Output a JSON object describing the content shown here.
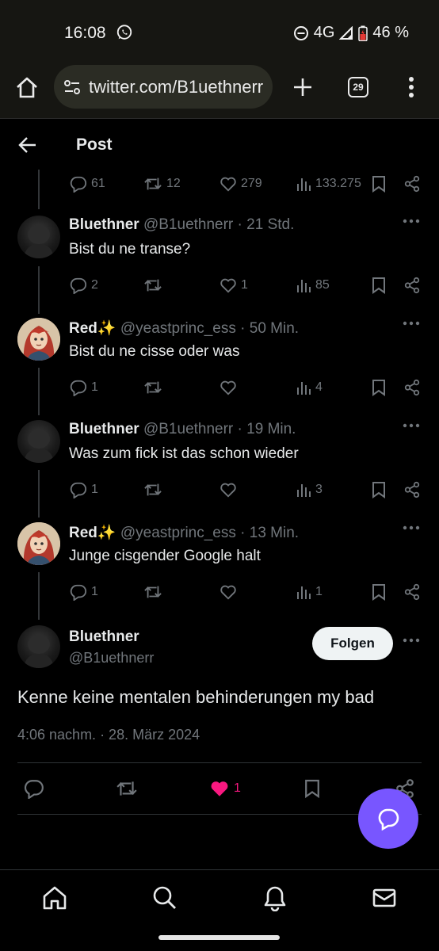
{
  "status_bar": {
    "time": "16:08",
    "network": "4G",
    "battery": "46 %"
  },
  "browser": {
    "url": "twitter.com/B1uethnerr",
    "tab_count": "29"
  },
  "header": {
    "title": "Post"
  },
  "top_actions": {
    "replies": "61",
    "reposts": "12",
    "likes": "279",
    "views": "133.275"
  },
  "replies": [
    {
      "name": "Bluethner",
      "handle": "@B1uethnerr",
      "time": "· 21 Std.",
      "text": "Bist du ne transe?",
      "avatar": "dark",
      "replies": "2",
      "reposts": "",
      "likes": "1",
      "views": "85"
    },
    {
      "name": "Red✨",
      "handle": "@yeastprinc_ess",
      "time": "· 50 Min.",
      "text": "Bist du ne cisse oder was",
      "avatar": "red",
      "replies": "1",
      "reposts": "",
      "likes": "",
      "views": "4"
    },
    {
      "name": "Bluethner",
      "handle": "@B1uethnerr",
      "time": "· 19 Min.",
      "text": "Was zum fick ist das schon wieder",
      "avatar": "dark",
      "replies": "1",
      "reposts": "",
      "likes": "",
      "views": "3"
    },
    {
      "name": "Red✨",
      "handle": "@yeastprinc_ess",
      "time": "· 13 Min.",
      "text": "Junge cisgender Google halt",
      "avatar": "red",
      "replies": "1",
      "reposts": "",
      "likes": "",
      "views": "1"
    }
  ],
  "main_post": {
    "name": "Bluethner",
    "handle": "@B1uethnerr",
    "follow_label": "Folgen",
    "text": "Kenne keine mentalen behinderungen my bad",
    "timestamp": "4:06 nachm. · 28. März 2024",
    "likes": "1",
    "like_color": "#f91880"
  },
  "colors": {
    "accent": "#7856ff",
    "muted": "#71767b",
    "background": "#000000"
  }
}
